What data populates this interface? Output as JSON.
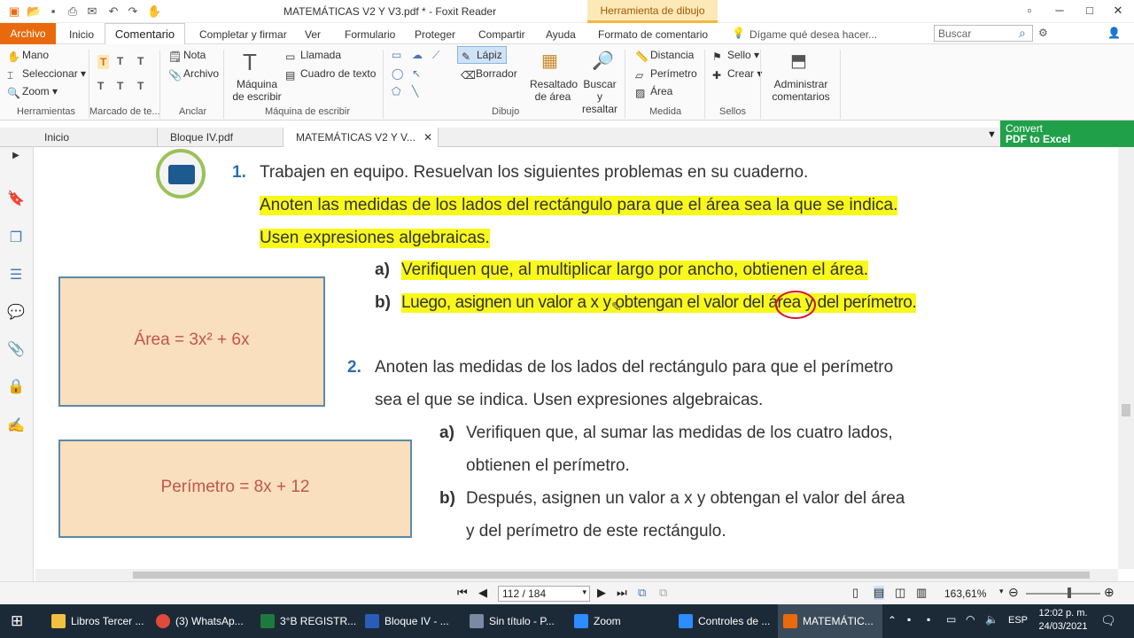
{
  "titlebar": {
    "title": "MATEMÁTICAS V2 Y V3.pdf * - Foxit Reader",
    "draw_tool": "Herramienta de dibujo"
  },
  "tabs": [
    "Archivo",
    "Inicio",
    "Comentario",
    "Completar y firmar",
    "Ver",
    "Formulario",
    "Proteger",
    "Compartir",
    "Ayuda",
    "Formato de comentario"
  ],
  "tell_me": "Dígame qué desea hacer...",
  "search_placeholder": "Buscar",
  "ribbon": {
    "herramientas": [
      "Mano",
      "Seleccionar",
      "Zoom"
    ],
    "anclar": [
      "Nota",
      "Archivo"
    ],
    "maquina": [
      "Máquina de escribir",
      "Llamada",
      "Cuadro de texto"
    ],
    "dibujo": [
      "Lápiz",
      "Borrador"
    ],
    "resaltado": "Resaltado de área",
    "buscar": "Buscar y resaltar",
    "medida": [
      "Distancia",
      "Perímetro",
      "Área"
    ],
    "sellos": [
      "Sello",
      "Crear"
    ],
    "administrar": "Administrar comentarios",
    "groups": [
      "Herramientas",
      "Marcado de te...",
      "Anclar",
      "Máquina de escribir",
      "Dibujo",
      "Medida",
      "Sellos"
    ]
  },
  "doctabs": [
    "Inicio",
    "Bloque IV.pdf",
    "MATEMÁTICAS V2 Y V..."
  ],
  "convert": [
    "Convert",
    "PDF to Excel"
  ],
  "doc": {
    "p1_num": "1.",
    "p1_text": "Trabajen en equipo. Resuelvan los siguientes problemas en su cuaderno.",
    "p1_hl1": "Anoten las medidas de los lados del rectángulo para que el área sea la que se indica.",
    "p1_hl2": "Usen expresiones algebraicas.",
    "a1_label": "a)",
    "a1_text": "Verifiquen que, al multiplicar largo por ancho, obtienen el área.",
    "b1_label": "b)",
    "b1_text": "Luego, asignen un valor a x y obtengan el valor del área y del perímetro.",
    "box1": "Área = 3x² + 6x",
    "p2_num": "2.",
    "p2_line1": "Anoten las medidas de los lados del rectángulo para que el perímetro",
    "p2_line2": "sea el que se indica. Usen expresiones algebraicas.",
    "a2_label": "a)",
    "a2_line1": "Verifiquen que, al sumar las medidas de los cuatro lados,",
    "a2_line2": "obtienen el perímetro.",
    "b2_label": "b)",
    "b2_line1": "Después, asignen un valor a x y obtengan el valor del área",
    "b2_line2": "y del perímetro de este rectángulo.",
    "box2": "Perímetro = 8x + 12"
  },
  "status": {
    "page": "112 / 184",
    "zoom": "163,61%"
  },
  "taskbar": [
    {
      "label": "Libros Tercer ...",
      "color": "#f0c040"
    },
    {
      "label": "(3) WhatsAp...",
      "color": "#e04a3a"
    },
    {
      "label": "3°B REGISTR...",
      "color": "#1e7a3c"
    },
    {
      "label": "Bloque IV - ...",
      "color": "#2b5db8"
    },
    {
      "label": "Sin título - P...",
      "color": "#7a8aa0"
    },
    {
      "label": "Zoom",
      "color": "#2d8cff"
    },
    {
      "label": "Controles de ...",
      "color": "#2d8cff"
    },
    {
      "label": "MATEMÁTIC...",
      "color": "#e86a0c"
    }
  ],
  "tray": {
    "lang": "ESP",
    "time": "12:02 p. m.",
    "date": "24/03/2021"
  }
}
